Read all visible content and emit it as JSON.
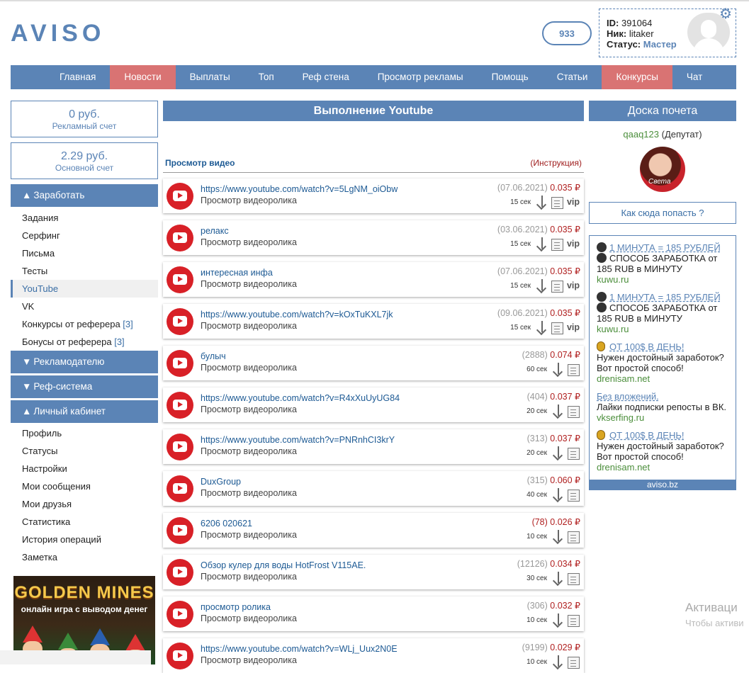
{
  "header": {
    "logo": "AVISO",
    "balance_pill": "933",
    "user": {
      "id_label": "ID:",
      "id": "391064",
      "nick_label": "Ник:",
      "nick": "litaker",
      "status_label": "Статус:",
      "status": "Мастер"
    }
  },
  "nav": [
    "Главная",
    "Новости",
    "Выплаты",
    "Топ",
    "Реф стена",
    "Просмотр рекламы",
    "Помощь",
    "Статьи",
    "Конкурсы",
    "Чат"
  ],
  "accounts": [
    {
      "amount": "0 руб.",
      "label": "Рекламный счет"
    },
    {
      "amount": "2.29 руб.",
      "label": "Основной счет"
    }
  ],
  "sidebar": {
    "earn": {
      "title": "Заработать",
      "items": [
        "Задания",
        "Серфинг",
        "Письма",
        "Тесты",
        "YouTube",
        "VK",
        "Конкурсы от реферера",
        "Бонусы от реферера"
      ],
      "counts": {
        "6": "[3]",
        "7": "[3]"
      }
    },
    "advertiser": "Рекламодателю",
    "ref": "Реф-система",
    "cabinet": {
      "title": "Личный кабинет",
      "items": [
        "Профиль",
        "Статусы",
        "Настройки",
        "Мои сообщения",
        "Мои друзья",
        "Статистика",
        "История операций",
        "Заметка"
      ]
    }
  },
  "banner": {
    "title": "GOLDEN MINES",
    "subtitle": "онлайн игра с выводом денег"
  },
  "main": {
    "title": "Выполнение Youtube",
    "subtitle": "Просмотр видео",
    "instruction": "(Инструкция)",
    "tasks": [
      {
        "title": "https://www.youtube.com/watch?v=5LgNM_oiObw",
        "desc": "Просмотр видеоролика",
        "stat": "(07.06.2021)",
        "price": "0.035 ₽",
        "secs": "15 сек",
        "vip": "vip"
      },
      {
        "title": "релакс",
        "desc": "Просмотр видеоролика",
        "stat": "(03.06.2021)",
        "price": "0.035 ₽",
        "secs": "15 сек",
        "vip": "vip"
      },
      {
        "title": "интересная инфа",
        "desc": "Просмотр видеоролика",
        "stat": "(07.06.2021)",
        "price": "0.035 ₽",
        "secs": "15 сек",
        "vip": "vip"
      },
      {
        "title": "https://www.youtube.com/watch?v=kOxTuKXL7jk",
        "desc": "Просмотр видеоролика",
        "stat": "(09.06.2021)",
        "price": "0.035 ₽",
        "secs": "15 сек",
        "vip": "vip"
      },
      {
        "title": "булыч",
        "desc": "Просмотр видеоролика",
        "stat": "(2888)",
        "price": "0.074 ₽",
        "secs": "60 сек",
        "vip": ""
      },
      {
        "title": "https://www.youtube.com/watch?v=R4xXuUyUG84",
        "desc": "Просмотр видеоролика",
        "stat": "(404)",
        "price": "0.037 ₽",
        "secs": "20 сек",
        "vip": ""
      },
      {
        "title": "https://www.youtube.com/watch?v=PNRnhCI3krY",
        "desc": "Просмотр видеоролика",
        "stat": "(313)",
        "price": "0.037 ₽",
        "secs": "20 сек",
        "vip": ""
      },
      {
        "title": "DuxGroup",
        "desc": "Просмотр видеоролика",
        "stat": "(315)",
        "price": "0.060 ₽",
        "secs": "40 сек",
        "vip": ""
      },
      {
        "title": "6206 020621",
        "desc": "Просмотр видеоролика",
        "stat": "(78)",
        "price": "0.026 ₽",
        "secs": "10 сек",
        "vip": "",
        "stat_red": true
      },
      {
        "title": "Обзор кулер для воды HotFrost V115AE.",
        "desc": "Просмотр видеоролика",
        "stat": "(12126)",
        "price": "0.034 ₽",
        "secs": "30 сек",
        "vip": ""
      },
      {
        "title": "просмотр ролика",
        "desc": "Просмотр видеоролика",
        "stat": "(306)",
        "price": "0.032 ₽",
        "secs": "10 сек",
        "vip": ""
      },
      {
        "title": "https://www.youtube.com/watch?v=WLj_Uux2N0E",
        "desc": "Просмотр видеоролика",
        "stat": "(9199)",
        "price": "0.029 ₽",
        "secs": "10 сек",
        "vip": ""
      }
    ]
  },
  "board": {
    "title": "Доска почета",
    "leader_name": "qaaq123",
    "leader_role": "(Депутат)",
    "photo_caption": "Света",
    "how_button": "Как сюда попасть ?"
  },
  "ads": [
    {
      "head": "1 МИНУТА = 185 РУБЛЕЙ",
      "text": "СПОСОБ ЗАРАБОТКА от 185 RUB в МИНУТУ",
      "domain": "kuwu.ru"
    },
    {
      "head": "1 МИНУТА = 185 РУБЛЕЙ",
      "text": "СПОСОБ ЗАРАБОТКА от 185 RUB в МИНУТУ",
      "domain": "kuwu.ru"
    },
    {
      "head": "ОТ 100$ В ДЕНЬ!",
      "text": "Нужен достойный заработок? Вот простой способ!",
      "domain": "drenisam.net"
    },
    {
      "head": "Без вложений.",
      "text": "Лайки подписки репосты в ВК.",
      "domain": "vkserfing.ru"
    },
    {
      "head": "ОТ 100$ В ДЕНЬ!",
      "text": "Нужен достойный заработок? Вот простой способ!",
      "domain": "drenisam.net"
    }
  ],
  "ads_footer": "aviso.bz",
  "watermark": {
    "line1": "Активаци",
    "line2": "Чтобы активи"
  }
}
